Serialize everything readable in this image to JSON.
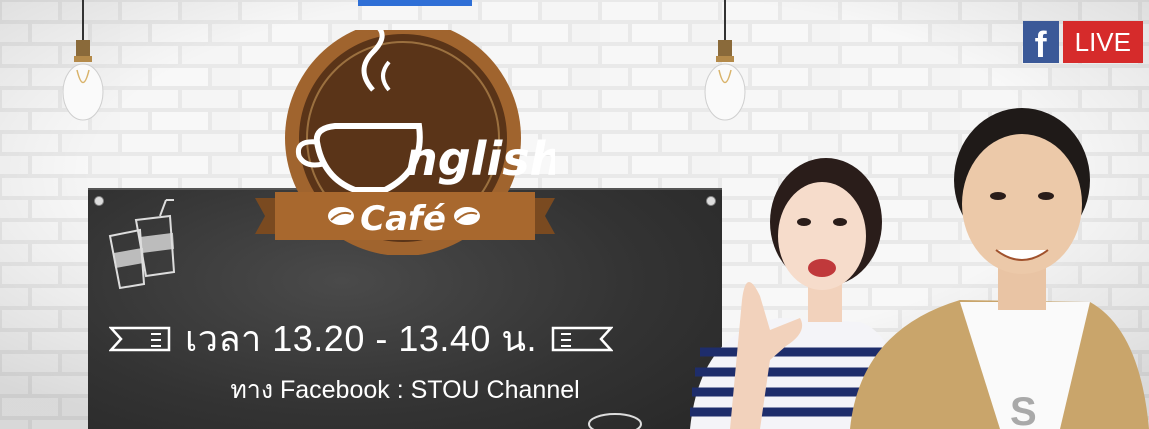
{
  "show": {
    "logo_line1": "nglish",
    "logo_line2": "Café",
    "time_text": "เวลา 13.20 - 13.40 น.",
    "channel_text": "ทาง Facebook : STOU Channel"
  },
  "badge": {
    "fb_letter": "f",
    "live_label": "LIVE"
  },
  "colors": {
    "logo_brown": "#5a3418",
    "ribbon": "#a0642e",
    "live_red": "#d62b2b",
    "facebook_blue": "#3b5998"
  },
  "icons": [
    "coffee-cup-logo-icon",
    "coffee-bean-icon",
    "takeaway-cups-icon",
    "light-bulb-icon",
    "ribbon-scroll-icon",
    "facebook-icon"
  ]
}
